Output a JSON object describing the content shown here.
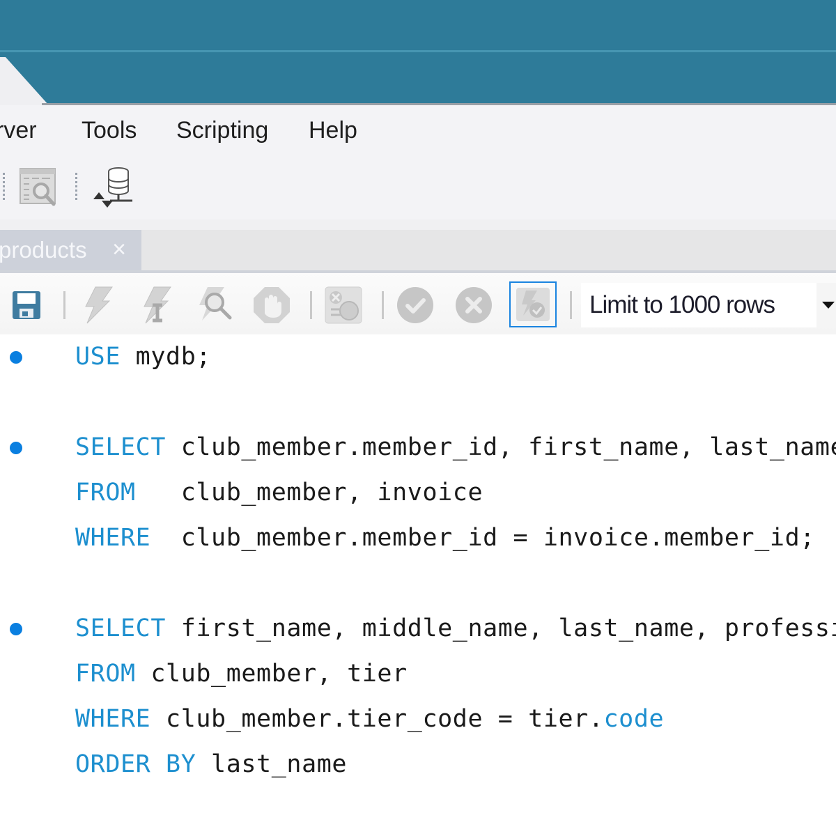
{
  "window": {
    "accent_color": "#2e7b99"
  },
  "menubar": {
    "items": [
      {
        "label": "rver"
      },
      {
        "label": "Tools"
      },
      {
        "label": "Scripting"
      },
      {
        "label": "Help"
      }
    ]
  },
  "main_toolbar": {
    "icons": [
      "table-inspector-icon",
      "database-migration-icon"
    ]
  },
  "editor_tabs": [
    {
      "label": "products",
      "close_glyph": "×",
      "active": true
    }
  ],
  "sql_toolbar": {
    "buttons": [
      {
        "name": "save-script",
        "icon": "floppy-disk-icon",
        "enabled": true
      },
      {
        "name": "execute-all",
        "icon": "lightning-icon",
        "enabled": false
      },
      {
        "name": "execute-current",
        "icon": "lightning-cursor-icon",
        "enabled": false
      },
      {
        "name": "explain",
        "icon": "magnifier-lightning-icon",
        "enabled": false
      },
      {
        "name": "stop",
        "icon": "stop-hand-icon",
        "enabled": false
      },
      {
        "name": "toggle-continue-on-error",
        "icon": "toggle-error-icon",
        "enabled": false
      },
      {
        "name": "commit",
        "icon": "check-circle-icon",
        "enabled": false
      },
      {
        "name": "rollback",
        "icon": "x-circle-icon",
        "enabled": false
      },
      {
        "name": "autocommit",
        "icon": "autocommit-icon",
        "enabled": false,
        "focused": true
      }
    ],
    "limit_select": {
      "value": "Limit to 1000 rows",
      "arrow": "▼"
    }
  },
  "editor": {
    "statement_marker_color": "#0a7fe0",
    "keyword_color": "#1d8fcf",
    "lines": [
      {
        "marker": true,
        "tokens": [
          {
            "t": "USE",
            "kw": true
          },
          {
            "t": " mydb;"
          }
        ]
      },
      {
        "marker": false,
        "tokens": []
      },
      {
        "marker": true,
        "tokens": [
          {
            "t": "SELECT",
            "kw": true
          },
          {
            "t": " club_member.member_id, first_name, last_name"
          }
        ]
      },
      {
        "marker": false,
        "tokens": [
          {
            "t": "FROM",
            "kw": true
          },
          {
            "t": "   club_member, invoice"
          }
        ]
      },
      {
        "marker": false,
        "tokens": [
          {
            "t": "WHERE",
            "kw": true
          },
          {
            "t": "  club_member.member_id = invoice.member_id;"
          }
        ]
      },
      {
        "marker": false,
        "tokens": []
      },
      {
        "marker": true,
        "tokens": [
          {
            "t": "SELECT",
            "kw": true
          },
          {
            "t": " first_name, middle_name, last_name, professi"
          }
        ]
      },
      {
        "marker": false,
        "tokens": [
          {
            "t": "FROM",
            "kw": true
          },
          {
            "t": " club_member, tier"
          }
        ]
      },
      {
        "marker": false,
        "tokens": [
          {
            "t": "WHERE",
            "kw": true
          },
          {
            "t": " club_member.tier_code = tier."
          },
          {
            "t": "code",
            "kw": true
          }
        ]
      },
      {
        "marker": false,
        "tokens": [
          {
            "t": "ORDER BY",
            "kw": true
          },
          {
            "t": " last_name"
          }
        ]
      }
    ]
  }
}
